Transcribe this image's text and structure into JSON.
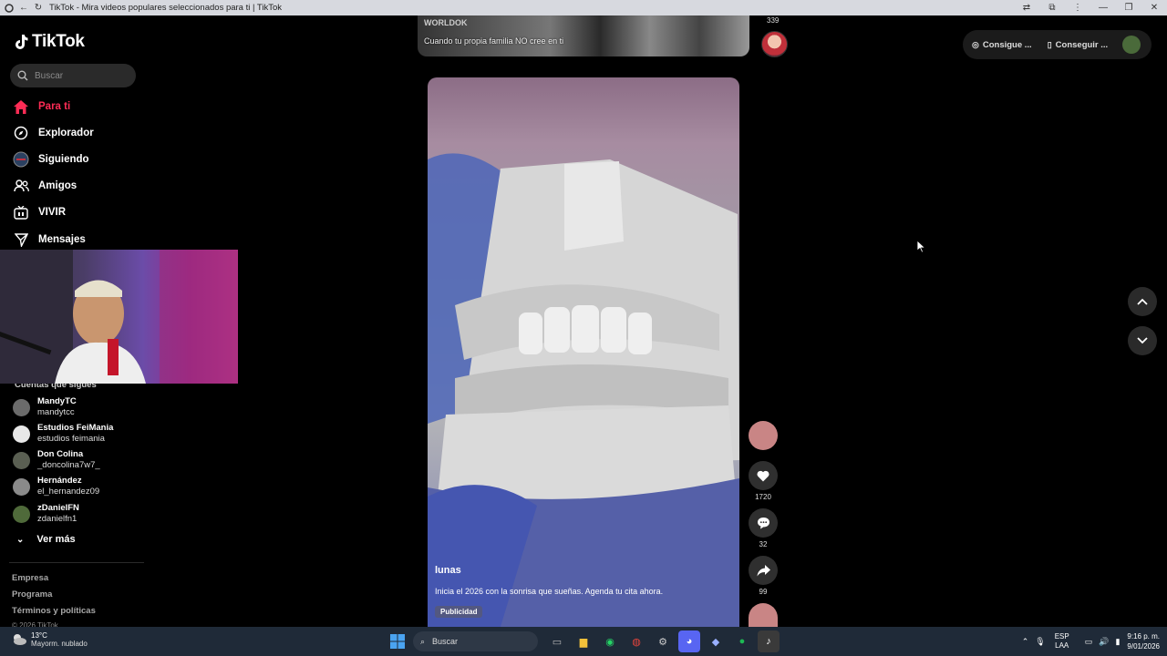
{
  "window": {
    "title": "TikTok - Mira videos populares seleccionados para ti | TikTok"
  },
  "sidebar": {
    "logo": "TikTok",
    "search_placeholder": "Buscar",
    "nav": [
      {
        "label": "Para ti",
        "icon": "home-icon",
        "active": true
      },
      {
        "label": "Explorador",
        "icon": "compass-icon"
      },
      {
        "label": "Siguiendo",
        "icon": "following-avatar-icon"
      },
      {
        "label": "Amigos",
        "icon": "friends-icon"
      },
      {
        "label": "VIVIR",
        "icon": "live-tv-icon"
      },
      {
        "label": "Mensajes",
        "icon": "send-icon"
      }
    ],
    "following_title": "Cuentas que sigues",
    "accounts": [
      {
        "name": "MandyTC",
        "handle": "mandytcc"
      },
      {
        "name": "Estudios FeiMania",
        "handle": "estudios feimania"
      },
      {
        "name": "Don Colina",
        "handle": "_doncolina7w7_"
      },
      {
        "name": "Hernández",
        "handle": "el_hernandez09"
      },
      {
        "name": "zDanielFN",
        "handle": "zdanielfn1"
      }
    ],
    "see_more": "Ver más",
    "footer": [
      "Empresa",
      "Programa",
      "Términos y políticas"
    ],
    "copyright": "© 2026 TikTok"
  },
  "top_video": {
    "username": "WORLDOK",
    "caption": "Cuando tu propia familia NO cree en ti",
    "count": "339"
  },
  "video": {
    "username": "lunas",
    "caption": "Inicia el 2026 con la sonrisa que sueñas. Agenda tu cita ahora.",
    "badge": "Publicidad",
    "likes": "1720",
    "comments": "32",
    "shares": "99"
  },
  "header_pills": {
    "coins": "Consigue ...",
    "app": "Conseguir ..."
  },
  "taskbar": {
    "temperature": "13°C",
    "weather": "Mayorm. nublado",
    "search": "Buscar",
    "lang_top": "ESP",
    "lang_bottom": "LAA",
    "time": "9:16 p. m.",
    "date": "9/01/2026"
  },
  "colors": {
    "accent": "#fe2c55",
    "taskbar": "#1f2a38"
  }
}
